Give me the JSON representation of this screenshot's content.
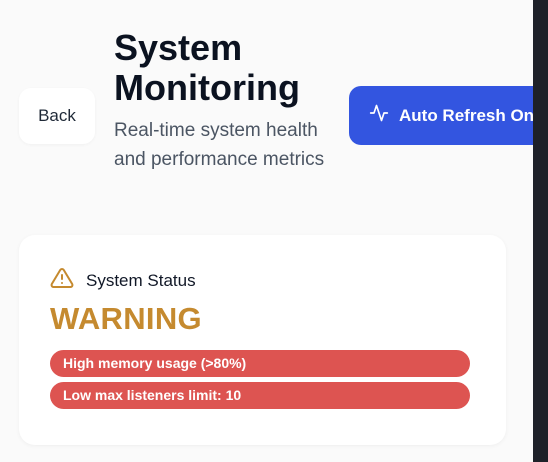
{
  "header": {
    "back_label": "Back",
    "title": "System Monitoring",
    "subtitle": "Real-time system health and performance metrics",
    "auto_refresh_label": "Auto Refresh On",
    "auto_refresh_icon": "activity-icon"
  },
  "status": {
    "title": "System Status",
    "icon": "warning-icon",
    "value": "WARNING",
    "value_color": "#c58a2f",
    "alerts": [
      {
        "text": "High memory usage (>80%)"
      },
      {
        "text": "Low max listeners limit: 10"
      }
    ],
    "alert_color": "#dd5451"
  },
  "colors": {
    "accent": "#3355e0",
    "background": "#fafafa",
    "card": "#ffffff"
  }
}
